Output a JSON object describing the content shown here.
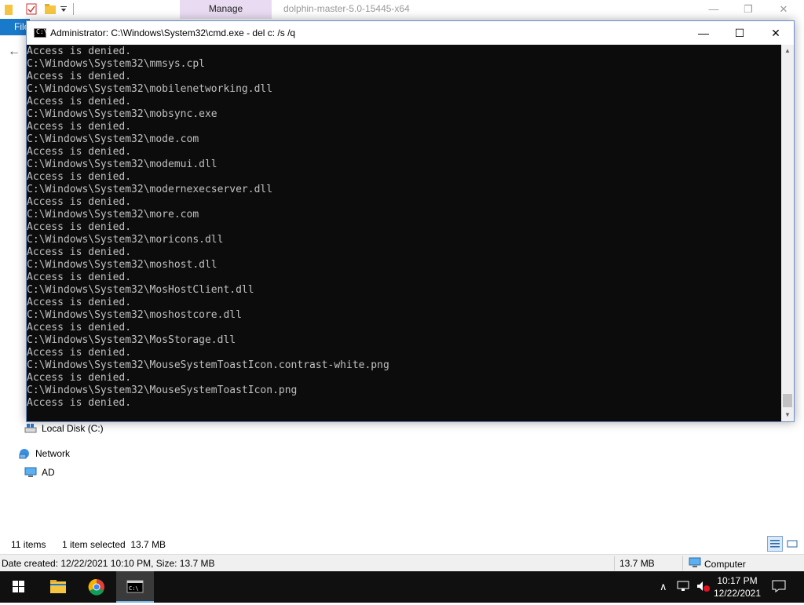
{
  "explorer": {
    "manage_tab": "Manage",
    "title": "dolphin-master-5.0-15445-x64",
    "file_tab": "File",
    "nav": {
      "local_disk": "Local Disk (C:)",
      "network": "Network",
      "ad": "AD"
    },
    "status": {
      "items": "11 items",
      "selected": "1 item selected  13.7 MB"
    },
    "details": {
      "text": "Date created: 12/22/2021 10:10 PM, Size: 13.7 MB",
      "size": "13.7 MB",
      "computer": "Computer"
    }
  },
  "cmd": {
    "title": "Administrator: C:\\Windows\\System32\\cmd.exe - del  c: /s /q",
    "icon_label": "C:\\_",
    "lines": [
      "Access is denied.",
      "C:\\Windows\\System32\\mmsys.cpl",
      "Access is denied.",
      "C:\\Windows\\System32\\mobilenetworking.dll",
      "Access is denied.",
      "C:\\Windows\\System32\\mobsync.exe",
      "Access is denied.",
      "C:\\Windows\\System32\\mode.com",
      "Access is denied.",
      "C:\\Windows\\System32\\modemui.dll",
      "Access is denied.",
      "C:\\Windows\\System32\\modernexecserver.dll",
      "Access is denied.",
      "C:\\Windows\\System32\\more.com",
      "Access is denied.",
      "C:\\Windows\\System32\\moricons.dll",
      "Access is denied.",
      "C:\\Windows\\System32\\moshost.dll",
      "Access is denied.",
      "C:\\Windows\\System32\\MosHostClient.dll",
      "Access is denied.",
      "C:\\Windows\\System32\\moshostcore.dll",
      "Access is denied.",
      "C:\\Windows\\System32\\MosStorage.dll",
      "Access is denied.",
      "C:\\Windows\\System32\\MouseSystemToastIcon.contrast-white.png",
      "Access is denied.",
      "C:\\Windows\\System32\\MouseSystemToastIcon.png",
      "Access is denied."
    ]
  },
  "taskbar": {
    "time": "10:17 PM",
    "date": "12/22/2021"
  },
  "colors": {
    "console_bg": "#0c0c0c",
    "console_text": "#c0c0c0",
    "taskbar_bg": "#101010",
    "manage_tab_bg": "#e9dcf2",
    "file_tab_bg": "#1979ca"
  }
}
